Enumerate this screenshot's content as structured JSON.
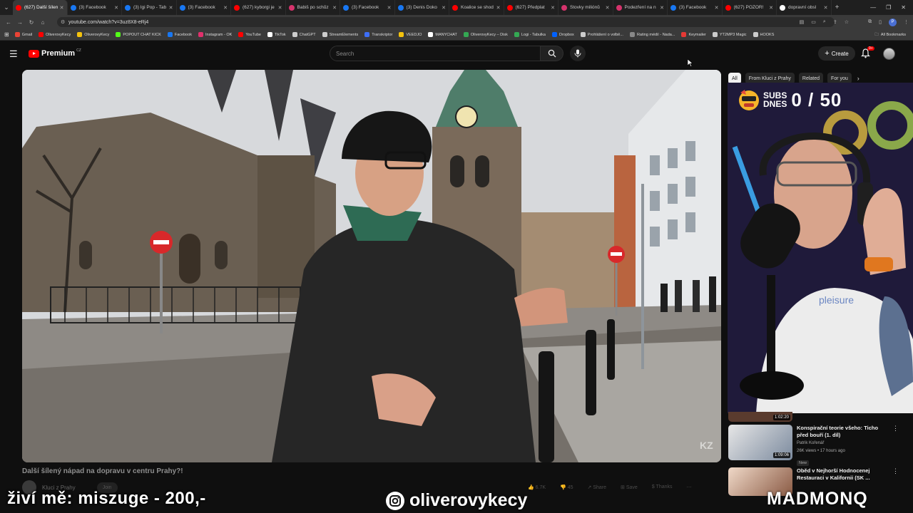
{
  "browser": {
    "tabs": [
      {
        "title": "(627) Další šílený",
        "color": "#ff0000",
        "active": true
      },
      {
        "title": "(3) Facebook",
        "color": "#1877f2"
      },
      {
        "title": "(3) Igi Pop - Tab",
        "color": "#1877f2"
      },
      {
        "title": "(3) Facebook",
        "color": "#1877f2"
      },
      {
        "title": "(627) kyborgi je",
        "color": "#ff0000"
      },
      {
        "title": "Babiš po schůz",
        "color": "#d6336c"
      },
      {
        "title": "(3) Facebook",
        "color": "#1877f2"
      },
      {
        "title": "(3) Denis Doko",
        "color": "#1877f2"
      },
      {
        "title": "Koalice se shod",
        "color": "#ff0000"
      },
      {
        "title": "(627) Předplat",
        "color": "#ff0000"
      },
      {
        "title": "Stovky miliónů",
        "color": "#d6336c"
      },
      {
        "title": "Podezření na n",
        "color": "#d6336c"
      },
      {
        "title": "(3) Facebook",
        "color": "#1877f2"
      },
      {
        "title": "(627) POZOR!",
        "color": "#ff0000"
      },
      {
        "title": "dopravní obsl",
        "color": "#ffffff"
      }
    ],
    "url": "youtube.com/watch?v=3uz8X8-eRj4",
    "bookmarks": [
      {
        "label": "Gmail",
        "color": "#ea4335"
      },
      {
        "label": "OliverovyKecy",
        "color": "#ff0000"
      },
      {
        "label": "OliverovyKecy",
        "color": "#f4c20d"
      },
      {
        "label": "POPOUT CHAT KICK",
        "color": "#53fc18"
      },
      {
        "label": "Facebook",
        "color": "#1877f2"
      },
      {
        "label": "Instagram - OK",
        "color": "#e1306c"
      },
      {
        "label": "YouTube",
        "color": "#ff0000"
      },
      {
        "label": "TikTok",
        "color": "#ffffff"
      },
      {
        "label": "ChatGPT",
        "color": "#cccccc"
      },
      {
        "label": "StreamElements",
        "color": "#cccccc"
      },
      {
        "label": "Transkriptor",
        "color": "#3d6ef5"
      },
      {
        "label": "VEEDJO",
        "color": "#f4c20d"
      },
      {
        "label": "MANYCHAT",
        "color": "#ffffff"
      },
      {
        "label": "OliverovyKecy – Disk",
        "color": "#34a853"
      },
      {
        "label": "Logi - Tabulka",
        "color": "#34a853"
      },
      {
        "label": "Dropbox",
        "color": "#0061fe"
      },
      {
        "label": "Prohlášení o volbě...",
        "color": "#cccccc"
      },
      {
        "label": "Rating médií - Nada...",
        "color": "#888888"
      },
      {
        "label": "Keymailer",
        "color": "#e53935"
      },
      {
        "label": "YT2MP3 Magic",
        "color": "#cccccc"
      },
      {
        "label": "HOOKS",
        "color": "#cccccc"
      }
    ],
    "all_bookmarks": "All Bookmarks",
    "profile_letter": "P"
  },
  "youtube": {
    "logo": "Premium",
    "country": "CZ",
    "search_placeholder": "Search",
    "create_label": "Create",
    "notifications_badge": "9+",
    "video_title": "Další šílený nápad na dopravu v centru Prahy?!",
    "channel_name": "Kluci z Prahy",
    "subscribe_label": "Join",
    "watermark": "KZ",
    "actions": {
      "likes": "6.7K",
      "dislike_count": "45",
      "share": "Share",
      "save": "Save",
      "thanks": "Thanks"
    },
    "chips": [
      "All",
      "From Kluci z Prahy",
      "Related",
      "For you"
    ],
    "recommendations": [
      {
        "title": "",
        "channel": "",
        "meta": "",
        "duration": "1:02:20",
        "badge": ""
      },
      {
        "title": "Konspirační teorie všeho: Ticho před bouří (1. díl)",
        "channel": "Patrik Kořenář",
        "meta": "26K views • 17 hours ago",
        "duration": "1:09:06",
        "badge": "New"
      },
      {
        "title": "Oběd v Nejhorší Hodnocenej Restauraci v Kalifornii (SK ...",
        "channel": "",
        "meta": "",
        "duration": "",
        "badge": ""
      }
    ]
  },
  "overlay": {
    "subs_label_1": "SUBS",
    "subs_label_2": "DNES",
    "subs_count": "0 / 50",
    "donate_text": "živí mě: miszuge - 200,-",
    "handle": "oliverovykecy",
    "brand": "MADMONQ",
    "shirt_text": "pleisure"
  }
}
